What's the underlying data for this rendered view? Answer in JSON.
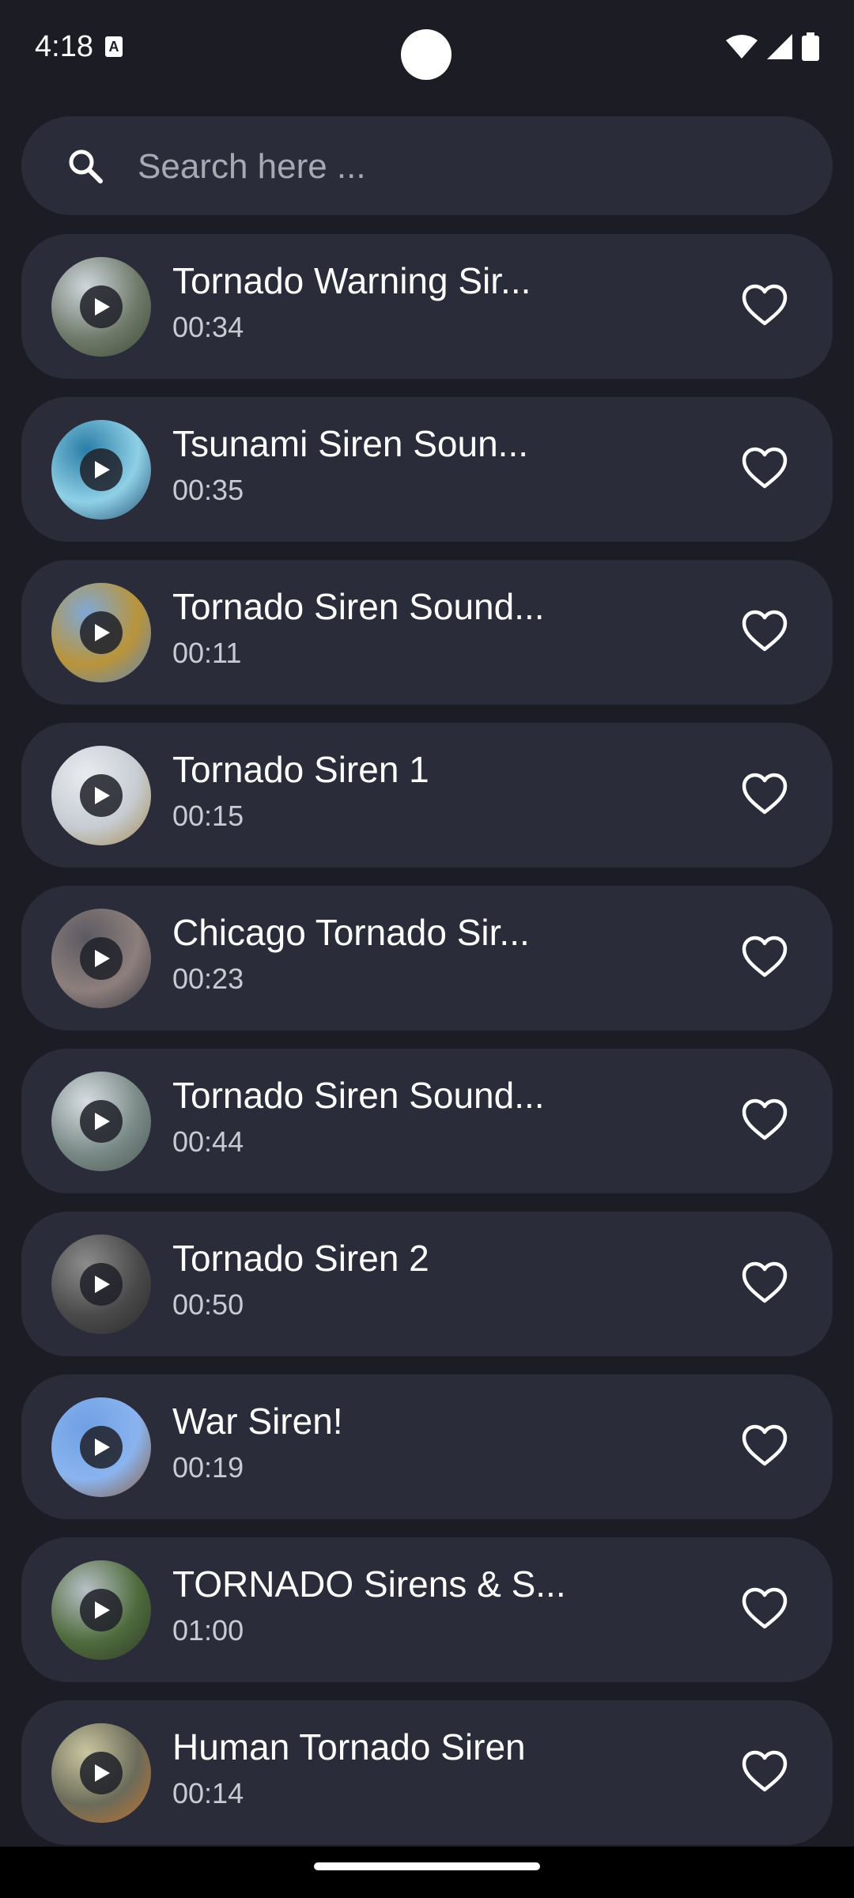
{
  "status": {
    "time": "4:18",
    "notif_icon": "a-icon"
  },
  "search": {
    "placeholder": "Search here ..."
  },
  "tracks": [
    {
      "title": "Tornado Warning Sir...",
      "duration": "00:34",
      "thumb_colors": [
        "#cfd6dc",
        "#6f7a6a",
        "#3e4a36"
      ]
    },
    {
      "title": "Tsunami Siren Soun...",
      "duration": "00:35",
      "thumb_colors": [
        "#2a7da6",
        "#8fd0e6",
        "#1e4d6e"
      ]
    },
    {
      "title": "Tornado Siren Sound...",
      "duration": "00:11",
      "thumb_colors": [
        "#7fa8d8",
        "#b9943a",
        "#5d87c0"
      ]
    },
    {
      "title": "Tornado Siren 1",
      "duration": "00:15",
      "thumb_colors": [
        "#e9ecef",
        "#c7ccd2",
        "#a38a52"
      ]
    },
    {
      "title": "Chicago Tornado Sir...",
      "duration": "00:23",
      "thumb_colors": [
        "#5b5a62",
        "#8d7f7c",
        "#3a3a42"
      ]
    },
    {
      "title": "Tornado Siren Sound...",
      "duration": "00:44",
      "thumb_colors": [
        "#d7dde2",
        "#7a8a86",
        "#4d5a58"
      ]
    },
    {
      "title": "Tornado Siren 2",
      "duration": "00:50",
      "thumb_colors": [
        "#8c8c8c",
        "#4a4a4a",
        "#2a2a2a"
      ]
    },
    {
      "title": "War Siren!",
      "duration": "00:19",
      "thumb_colors": [
        "#6f9fe4",
        "#8ab4ee",
        "#8a5a3a"
      ]
    },
    {
      "title": "TORNADO Sirens & S...",
      "duration": "01:00",
      "thumb_colors": [
        "#b7c0c6",
        "#4f6b3c",
        "#2f3a2a"
      ]
    },
    {
      "title": "Human Tornado Siren",
      "duration": "00:14",
      "thumb_colors": [
        "#c9c7a0",
        "#6b6b5a",
        "#c4732f"
      ]
    }
  ],
  "colors": {
    "background": "#1b1c24",
    "card": "#2a2c3a",
    "text": "#ffffff",
    "subtext": "#c9cad2"
  }
}
